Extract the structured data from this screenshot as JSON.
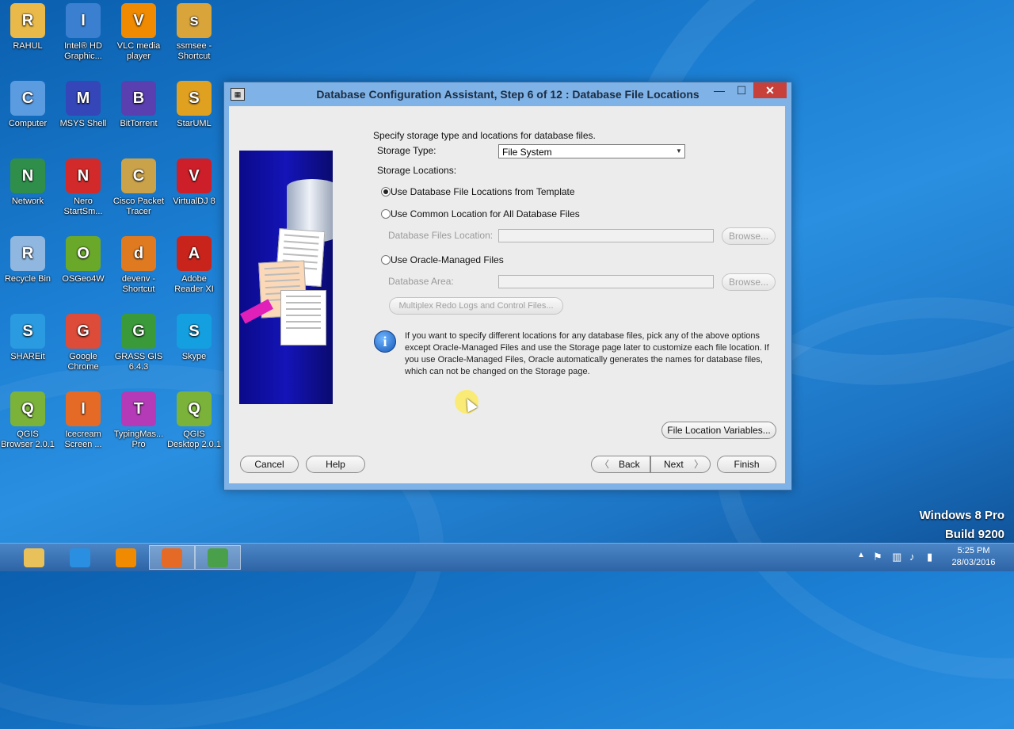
{
  "desktop": {
    "icons": [
      {
        "label": "RAHUL",
        "icon": "user-folder-icon",
        "color": "#e9b949"
      },
      {
        "label": "Intel® HD Graphic...",
        "icon": "intel-graphics-icon",
        "color": "#3a7fd0"
      },
      {
        "label": "VLC media player",
        "icon": "vlc-icon",
        "color": "#f08a00"
      },
      {
        "label": "ssmsee - Shortcut",
        "icon": "ssmsee-icon",
        "color": "#d9a43a"
      },
      {
        "label": "Computer",
        "icon": "computer-icon",
        "color": "#5b9be0"
      },
      {
        "label": "MSYS Shell",
        "icon": "msys-icon",
        "color": "#3546b8"
      },
      {
        "label": "BitTorrent",
        "icon": "bittorrent-icon",
        "color": "#5a3fb0"
      },
      {
        "label": "StarUML",
        "icon": "staruml-icon",
        "color": "#e0a020"
      },
      {
        "label": "Network",
        "icon": "network-icon",
        "color": "#2f8f4a"
      },
      {
        "label": "Nero StartSm...",
        "icon": "nero-icon",
        "color": "#d22a2a"
      },
      {
        "label": "Cisco Packet Tracer",
        "icon": "cisco-icon",
        "color": "#c9a24a"
      },
      {
        "label": "VirtualDJ 8",
        "icon": "virtualdj-icon",
        "color": "#cc1f2a"
      },
      {
        "label": "Recycle Bin",
        "icon": "recycle-bin-icon",
        "color": "#8fb7e0"
      },
      {
        "label": "OSGeo4W",
        "icon": "osgeo-icon",
        "color": "#6aa82a"
      },
      {
        "label": "devenv - Shortcut",
        "icon": "devenv-icon",
        "color": "#e07a20"
      },
      {
        "label": "Adobe Reader XI",
        "icon": "adobe-reader-icon",
        "color": "#c8241c"
      },
      {
        "label": "SHAREit",
        "icon": "shareit-icon",
        "color": "#2a9be0"
      },
      {
        "label": "Google Chrome",
        "icon": "chrome-icon",
        "color": "#dd4b39"
      },
      {
        "label": "GRASS GIS 6.4.3",
        "icon": "grass-gis-icon",
        "color": "#3a9a3a"
      },
      {
        "label": "Skype",
        "icon": "skype-icon",
        "color": "#14a0e0"
      },
      {
        "label": "QGIS Browser 2.0.1",
        "icon": "qgis-browser-icon",
        "color": "#7bb33a"
      },
      {
        "label": "Icecream Screen ...",
        "icon": "icecream-icon",
        "color": "#e56a25"
      },
      {
        "label": "TypingMas... Pro",
        "icon": "typingmaster-icon",
        "color": "#b43ab8"
      },
      {
        "label": "QGIS Desktop 2.0.1",
        "icon": "qgis-desktop-icon",
        "color": "#7bb33a"
      }
    ],
    "watermark_line1": "Windows 8 Pro",
    "watermark_line2": "Build 9200"
  },
  "window": {
    "title": "Database Configuration Assistant, Step 6 of 12 : Database File Locations",
    "title_icon": "oracle-window-icon",
    "minimize": "—",
    "maximize": "☐",
    "close": "✕"
  },
  "form": {
    "intro": "Specify storage type and locations for database files.",
    "storage_type_label": "Storage Type:",
    "storage_type_value": "File System",
    "storage_locations_label": "Storage Locations:",
    "option_template": "Use Database File Locations from Template",
    "option_common": "Use Common Location for All Database Files",
    "db_files_location_label": "Database Files Location:",
    "browse": "Browse...",
    "option_omf": "Use Oracle-Managed Files",
    "db_area_label": "Database Area:",
    "multiplex": "Multiplex Redo Logs and Control Files...",
    "info": "If you want to specify different locations for any database files, pick any of the above options except Oracle-Managed Files and use the Storage page later to customize each file location. If you use Oracle-Managed Files, Oracle automatically generates the names for database files, which can not be changed on the Storage page.",
    "file_location_variables": "File Location Variables..."
  },
  "footer": {
    "cancel": "Cancel",
    "help": "Help",
    "back": "Back",
    "back_arrow": "〈",
    "next": "Next",
    "next_arrow": "〉",
    "finish": "Finish"
  },
  "taskbar": {
    "apps": [
      {
        "icon": "file-explorer-icon",
        "color": "#e8c15a",
        "active": false
      },
      {
        "icon": "internet-explorer-icon",
        "color": "#2a8fe0",
        "active": false
      },
      {
        "icon": "vlc-icon",
        "color": "#f08a00",
        "active": false
      },
      {
        "icon": "icecream-icon",
        "color": "#e56a25",
        "active": true
      },
      {
        "icon": "oracle-dbca-icon",
        "color": "#4aa04a",
        "active": true
      }
    ],
    "tray_show_hidden": "▲",
    "time": "5:25 PM",
    "date": "28/03/2016"
  }
}
